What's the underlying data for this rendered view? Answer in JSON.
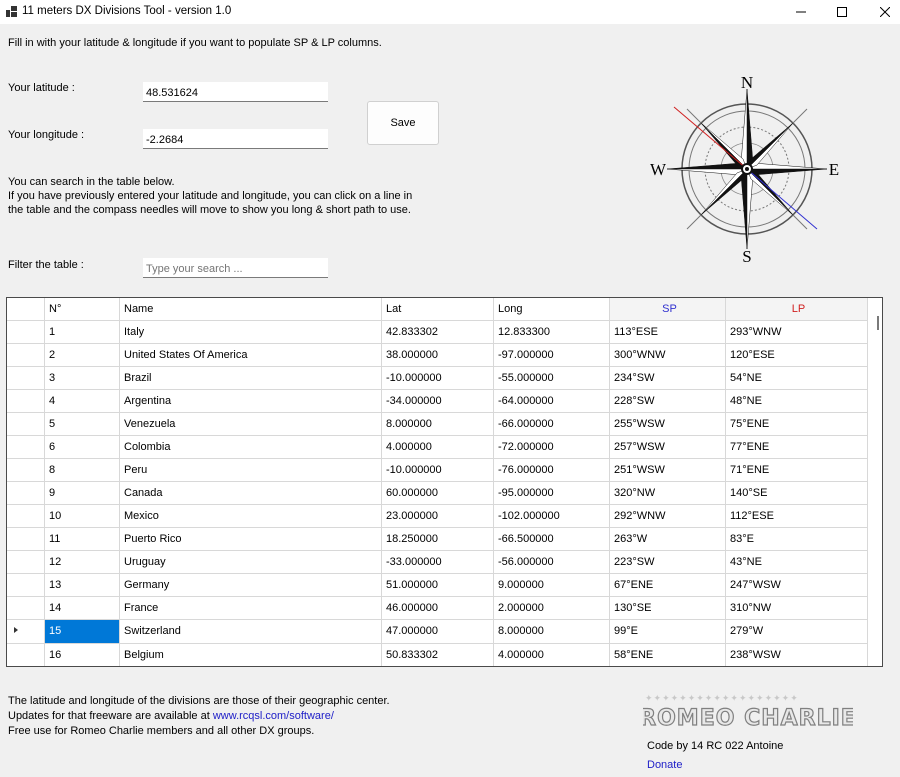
{
  "window": {
    "title": "11 meters DX Divisions Tool - version 1.0"
  },
  "intro_text": "Fill in with your latitude & longitude if you want to populate SP & LP columns.",
  "latitude": {
    "label": "Your latitude :",
    "value": "48.531624"
  },
  "longitude": {
    "label": "Your longitude :",
    "value": "-2.2684"
  },
  "save_button": "Save",
  "search_help": {
    "line1": "You can search in the table below.",
    "line2": "If you have previously entered your latitude and longitude, you can click on a line in",
    "line3": "the table and the compass needles will move to show you long & short path to use."
  },
  "filter": {
    "label": "Filter the table :",
    "placeholder": "Type your search ..."
  },
  "compass": {
    "north": "N",
    "south": "S",
    "east": "E",
    "west": "W"
  },
  "table": {
    "headers": {
      "num": "N°",
      "name": "Name",
      "lat": "Lat",
      "long": "Long",
      "sp": "SP",
      "lp": "LP"
    },
    "selected_row": 13,
    "rows": [
      {
        "num": "1",
        "name": "Italy",
        "lat": "42.833302",
        "long": "12.833300",
        "sp": "113°ESE",
        "lp": "293°WNW"
      },
      {
        "num": "2",
        "name": "United States Of America",
        "lat": "38.000000",
        "long": "-97.000000",
        "sp": "300°WNW",
        "lp": "120°ESE"
      },
      {
        "num": "3",
        "name": "Brazil",
        "lat": "-10.000000",
        "long": "-55.000000",
        "sp": "234°SW",
        "lp": "54°NE"
      },
      {
        "num": "4",
        "name": "Argentina",
        "lat": "-34.000000",
        "long": "-64.000000",
        "sp": "228°SW",
        "lp": "48°NE"
      },
      {
        "num": "5",
        "name": "Venezuela",
        "lat": "8.000000",
        "long": "-66.000000",
        "sp": "255°WSW",
        "lp": "75°ENE"
      },
      {
        "num": "6",
        "name": "Colombia",
        "lat": "4.000000",
        "long": "-72.000000",
        "sp": "257°WSW",
        "lp": "77°ENE"
      },
      {
        "num": "8",
        "name": "Peru",
        "lat": "-10.000000",
        "long": "-76.000000",
        "sp": "251°WSW",
        "lp": "71°ENE"
      },
      {
        "num": "9",
        "name": "Canada",
        "lat": "60.000000",
        "long": "-95.000000",
        "sp": "320°NW",
        "lp": "140°SE"
      },
      {
        "num": "10",
        "name": "Mexico",
        "lat": "23.000000",
        "long": "-102.000000",
        "sp": "292°WNW",
        "lp": "112°ESE"
      },
      {
        "num": "11",
        "name": "Puerto Rico",
        "lat": "18.250000",
        "long": "-66.500000",
        "sp": "263°W",
        "lp": "83°E"
      },
      {
        "num": "12",
        "name": "Uruguay",
        "lat": "-33.000000",
        "long": "-56.000000",
        "sp": "223°SW",
        "lp": "43°NE"
      },
      {
        "num": "13",
        "name": "Germany",
        "lat": "51.000000",
        "long": "9.000000",
        "sp": "67°ENE",
        "lp": "247°WSW"
      },
      {
        "num": "14",
        "name": "France",
        "lat": "46.000000",
        "long": "2.000000",
        "sp": "130°SE",
        "lp": "310°NW"
      },
      {
        "num": "15",
        "name": "Switzerland",
        "lat": "47.000000",
        "long": "8.000000",
        "sp": "99°E",
        "lp": "279°W"
      },
      {
        "num": "16",
        "name": "Belgium",
        "lat": "50.833302",
        "long": "4.000000",
        "sp": "58°ENE",
        "lp": "238°WSW"
      }
    ]
  },
  "footer": {
    "line1": "The latitude and longitude of the divisions are those of their geographic center.",
    "line2_prefix": "Updates for that freeware are available at ",
    "line2_link": "www.rcqsl.com/software/",
    "line3": "Free use for Romeo Charlie members and all other DX groups."
  },
  "credits": {
    "logo_text": "ROMEO CHARLIE",
    "code_by": "Code by 14 RC 022 Antoine",
    "donate": "Donate"
  },
  "colors": {
    "sp": "#3030d0",
    "lp": "#d02020",
    "selection": "#0078d7",
    "link": "#2020c8"
  }
}
